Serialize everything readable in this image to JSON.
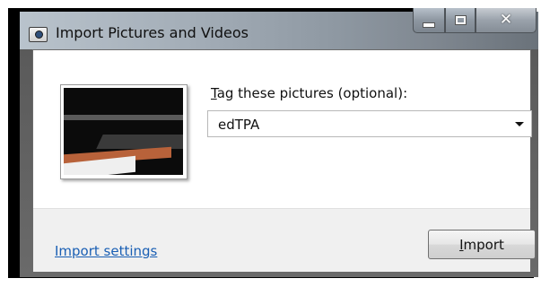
{
  "window": {
    "title": "Import Pictures and Videos"
  },
  "caption_buttons": {
    "minimize": "minimize-icon",
    "maximize": "maximize-icon",
    "close": "close-icon"
  },
  "thumbnail": {
    "alt": "preview"
  },
  "tag": {
    "label_access": "T",
    "label_rest": "ag these pictures (optional):",
    "value": "edTPA"
  },
  "footer": {
    "settings_link": "Import settings",
    "import_access": "I",
    "import_rest": "mport"
  }
}
